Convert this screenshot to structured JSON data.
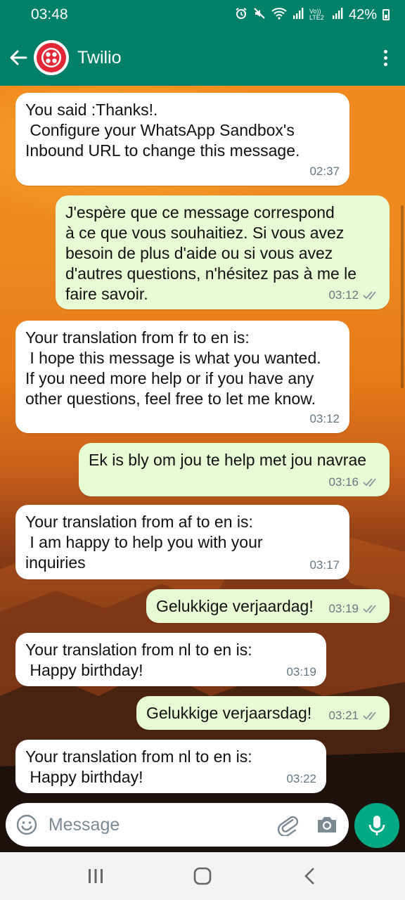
{
  "status_bar": {
    "time": "03:48",
    "network_label": "Vo)) LTE2",
    "battery_percent": "42%"
  },
  "header": {
    "contact_name": "Twilio",
    "avatar_icon": "twilio-logo-icon",
    "back_icon": "back-arrow-icon",
    "menu_icon": "more-vertical-icon"
  },
  "messages": [
    {
      "direction": "in",
      "text": "You said :Thanks!.\n Configure your WhatsApp Sandbox's\nInbound URL to change this message.",
      "time": "02:37"
    },
    {
      "direction": "out",
      "text": "J'espère que ce message correspond\nà ce que vous souhaitiez. Si vous avez\nbesoin de plus d'aide ou si vous avez\nd'autres questions, n'hésitez pas à me le\nfaire savoir.",
      "time": "03:12",
      "status": "read"
    },
    {
      "direction": "in",
      "text": "Your translation from fr to en is:\n I hope this message is what you wanted.\nIf you need more help or if you have any\nother questions, feel free to let me know.",
      "time": "03:12"
    },
    {
      "direction": "out",
      "text": "Ek is bly om jou te help met jou navrae",
      "time": "03:16",
      "status": "read"
    },
    {
      "direction": "in",
      "text": "Your translation from af to en is:\n I am happy to help you with your\ninquiries",
      "time": "03:17"
    },
    {
      "direction": "out",
      "text": "Gelukkige verjaardag!",
      "time": "03:19",
      "status": "read"
    },
    {
      "direction": "in",
      "text": "Your translation from nl to en is:\n Happy birthday!",
      "time": "03:19"
    },
    {
      "direction": "out",
      "text": "Gelukkige verjaarsdag!",
      "time": "03:21",
      "status": "read"
    },
    {
      "direction": "in",
      "text": "Your translation from nl to en is:\n Happy birthday!",
      "time": "03:22"
    }
  ],
  "composer": {
    "placeholder": "Message",
    "emoji_icon": "emoji-icon",
    "attach_icon": "paperclip-icon",
    "camera_icon": "camera-icon",
    "mic_icon": "microphone-icon"
  },
  "colors": {
    "header": "#008069",
    "incoming_bubble": "#ffffff",
    "outgoing_bubble": "#e7fcd4",
    "mic_button": "#00a884",
    "read_ticks": "#8696a0"
  }
}
